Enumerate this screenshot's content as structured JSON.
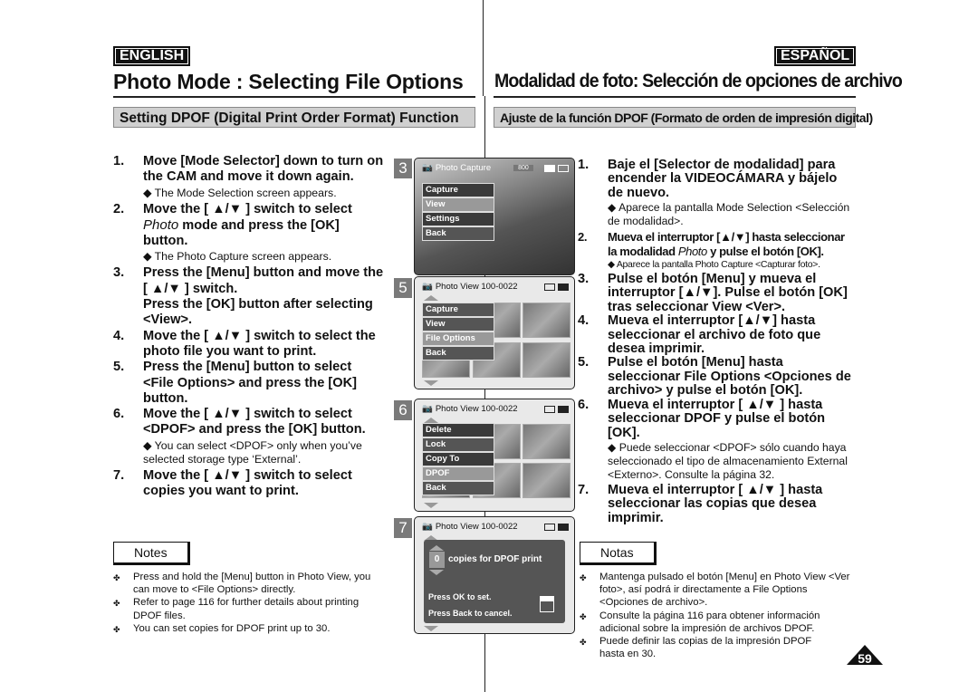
{
  "english": {
    "lang": "ENGLISH",
    "title": "Photo Mode : Selecting File Options",
    "section": "Setting DPOF (Digital Print Order Format) Function",
    "steps": [
      {
        "n": "1.",
        "text": "Move [Mode Selector] down to turn on the CAM and move it down again.",
        "sub": "◆ The Mode Selection screen appears."
      },
      {
        "n": "2.",
        "pre": "Move the [ ▲/▼ ] switch to select ",
        "em": "Photo",
        "post": " mode and press the [OK] button.",
        "sub": "◆ The Photo Capture screen appears."
      },
      {
        "n": "3.",
        "text": "Press the [Menu] button and move the [ ▲/▼ ] switch.",
        "text2": "Press the [OK] button after selecting <View>."
      },
      {
        "n": "4.",
        "text": "Move the [ ▲/▼ ] switch to select the photo file you want to print."
      },
      {
        "n": "5.",
        "text": "Press the [Menu] button to select <File Options> and press the [OK] button."
      },
      {
        "n": "6.",
        "text": "Move the [ ▲/▼ ] switch to select <DPOF> and press the [OK] button.",
        "sub": "◆ You can select <DPOF> only when you’ve selected storage type ‘External’."
      },
      {
        "n": "7.",
        "text": "Move the [ ▲/▼ ] switch to select copies you want to print."
      }
    ],
    "notes_label": "Notes",
    "notes": [
      "Press and hold the [Menu] button in Photo View, you can move to <File Options> directly.",
      "Refer to page 116 for further details about printing DPOF files.",
      "You can set copies for DPOF print up to 30."
    ]
  },
  "spanish": {
    "lang": "ESPAÑOL",
    "title": "Modalidad de foto: Selección de opciones de archivo",
    "section": "Ajuste de la función DPOF (Formato de orden de impresión digital)",
    "steps": [
      {
        "n": "1.",
        "text": "Baje el [Selector de modalidad] para encender la VIDEOCÁMARA y bájelo de nuevo.",
        "sub": "◆ Aparece la pantalla Mode Selection <Selección de modalidad>."
      },
      {
        "n": "2.",
        "pre": "Mueva el interruptor [▲/▼] hasta seleccionar la modalidad ",
        "em": "Photo",
        "post": " y pulse el botón [OK].",
        "sub": "◆ Aparece la pantalla Photo Capture <Capturar foto>."
      },
      {
        "n": "3.",
        "text": "Pulse el botón [Menu] y mueva el interruptor [▲/▼]. Pulse el botón [OK] tras seleccionar View <Ver>."
      },
      {
        "n": "4.",
        "text": "Mueva el interruptor [▲/▼] hasta seleccionar el archivo de foto que desea imprimir."
      },
      {
        "n": "5.",
        "text": "Pulse el botón [Menu] hasta seleccionar File Options <Opciones de archivo> y pulse el botón [OK]."
      },
      {
        "n": "6.",
        "text": "Mueva el interruptor [ ▲/▼ ] hasta seleccionar DPOF y pulse el botón [OK].",
        "sub": "◆ Puede seleccionar <DPOF> sólo cuando haya seleccionado el tipo de almacenamiento External <Externo>. Consulte la página 32."
      },
      {
        "n": "7.",
        "text": "Mueva el interruptor [ ▲/▼ ] hasta seleccionar las copias que desea imprimir."
      }
    ],
    "notes_label": "Notas",
    "notes": [
      "Mantenga pulsado el botón [Menu] en Photo View <Ver foto>, así podrá ir directamente a File Options <Opciones de archivo>.",
      "Consulte la página 116 para obtener información adicional sobre la impresión de archivos DPOF.",
      "Puede definir las copias de la impresión DPOF hasta en 30."
    ]
  },
  "screens": [
    {
      "num": "3",
      "title": "Photo Capture",
      "badge": "800",
      "menu": [
        "Capture",
        "View",
        "Settings",
        "Back"
      ],
      "selected": 1
    },
    {
      "num": "5",
      "title": "Photo View  100-0022",
      "menu": [
        "Capture",
        "View",
        "File Options",
        "Back"
      ],
      "selected": 2
    },
    {
      "num": "6",
      "title": "Photo View  100-0022",
      "menu": [
        "Delete",
        "Lock",
        "Copy To",
        "DPOF",
        "Back"
      ],
      "selected": 3
    },
    {
      "num": "7",
      "title": "Photo View  100-0022",
      "copies": "0",
      "copies_label": "copies for DPOF print",
      "ok_hint": "Press OK to set.",
      "back_hint": "Press Back to cancel."
    }
  ],
  "page_number": "59",
  "note_bullet": "✤"
}
